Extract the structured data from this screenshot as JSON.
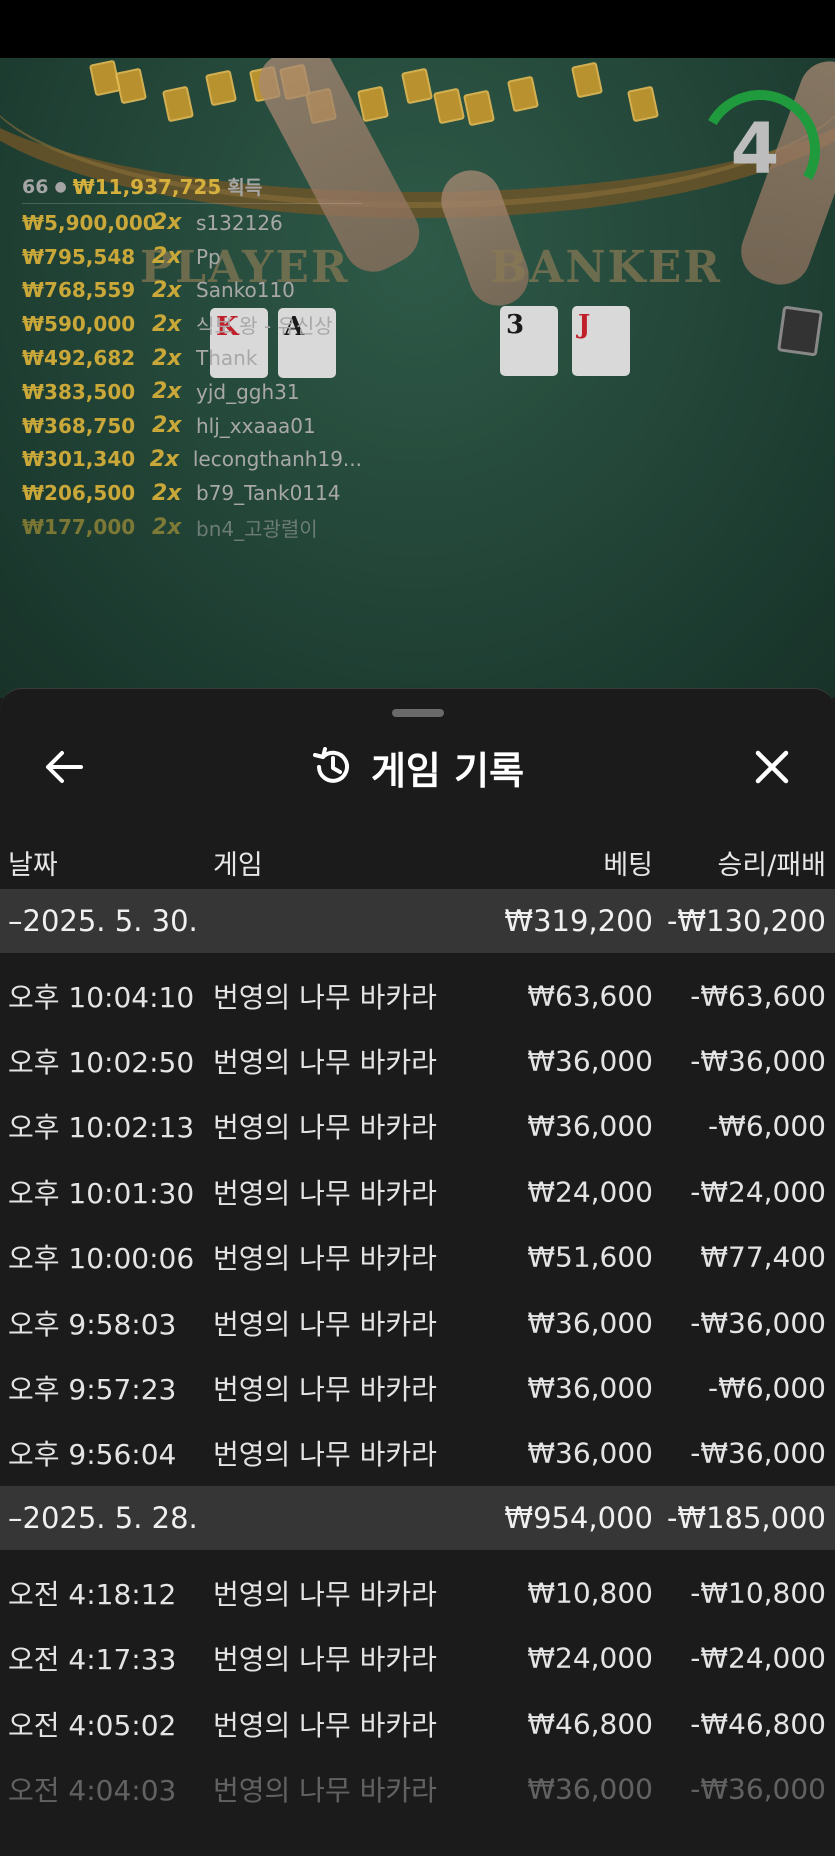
{
  "live_table": {
    "timer": "4",
    "player_label": "PLAYER",
    "banker_label": "BANKER",
    "player_cards": [
      "K",
      "A"
    ],
    "banker_cards": [
      "3",
      "J"
    ],
    "winners_header": {
      "count": "66",
      "total": "₩11,937,725",
      "suffix": "획득"
    },
    "winners": [
      {
        "amount": "₩5,900,000",
        "mult": "2x",
        "user": "s132126"
      },
      {
        "amount": "₩795,548",
        "mult": "2x",
        "user": "Pp"
      },
      {
        "amount": "₩768,559",
        "mult": "2x",
        "user": "Sanko110"
      },
      {
        "amount": "₩590,000",
        "mult": "2x",
        "user": "식보 왕 - 유신상"
      },
      {
        "amount": "₩492,682",
        "mult": "2x",
        "user": "Thank"
      },
      {
        "amount": "₩383,500",
        "mult": "2x",
        "user": "yjd_ggh31"
      },
      {
        "amount": "₩368,750",
        "mult": "2x",
        "user": "hlj_xxaaa01"
      },
      {
        "amount": "₩301,340",
        "mult": "2x",
        "user": "lecongthanh19..."
      },
      {
        "amount": "₩206,500",
        "mult": "2x",
        "user": "b79_Tank0114"
      },
      {
        "amount": "₩177,000",
        "mult": "2x",
        "user": "bn4_고광렬이"
      }
    ]
  },
  "sheet": {
    "title": "게임 기록",
    "columns": {
      "date": "날짜",
      "game": "게임",
      "bet": "베팅",
      "result": "승리/패배"
    },
    "groups": [
      {
        "date": "–2025. 5. 30.",
        "bet_total": "₩319,200",
        "result_total": "-₩130,200",
        "rows": [
          {
            "time": "오후 10:04:10",
            "game": "번영의 나무 바카라",
            "bet": "₩63,600",
            "result": "-₩63,600"
          },
          {
            "time": "오후 10:02:50",
            "game": "번영의 나무 바카라",
            "bet": "₩36,000",
            "result": "-₩36,000"
          },
          {
            "time": "오후 10:02:13",
            "game": "번영의 나무 바카라",
            "bet": "₩36,000",
            "result": "-₩6,000"
          },
          {
            "time": "오후 10:01:30",
            "game": "번영의 나무 바카라",
            "bet": "₩24,000",
            "result": "-₩24,000"
          },
          {
            "time": "오후 10:00:06",
            "game": "번영의 나무 바카라",
            "bet": "₩51,600",
            "result": "₩77,400"
          },
          {
            "time": "오후 9:58:03",
            "game": "번영의 나무 바카라",
            "bet": "₩36,000",
            "result": "-₩36,000"
          },
          {
            "time": "오후 9:57:23",
            "game": "번영의 나무 바카라",
            "bet": "₩36,000",
            "result": "-₩6,000"
          },
          {
            "time": "오후 9:56:04",
            "game": "번영의 나무 바카라",
            "bet": "₩36,000",
            "result": "-₩36,000"
          }
        ]
      },
      {
        "date": "–2025. 5. 28.",
        "bet_total": "₩954,000",
        "result_total": "-₩185,000",
        "rows": [
          {
            "time": "오전 4:18:12",
            "game": "번영의 나무 바카라",
            "bet": "₩10,800",
            "result": "-₩10,800"
          },
          {
            "time": "오전 4:17:33",
            "game": "번영의 나무 바카라",
            "bet": "₩24,000",
            "result": "-₩24,000"
          },
          {
            "time": "오전 4:05:02",
            "game": "번영의 나무 바카라",
            "bet": "₩46,800",
            "result": "-₩46,800"
          },
          {
            "time": "오전 4:04:03",
            "game": "번영의 나무 바카라",
            "bet": "₩36,000",
            "result": "-₩36,000"
          }
        ]
      }
    ]
  },
  "icons": {
    "back": "arrow-left-icon",
    "history": "history-icon",
    "close": "close-icon"
  }
}
